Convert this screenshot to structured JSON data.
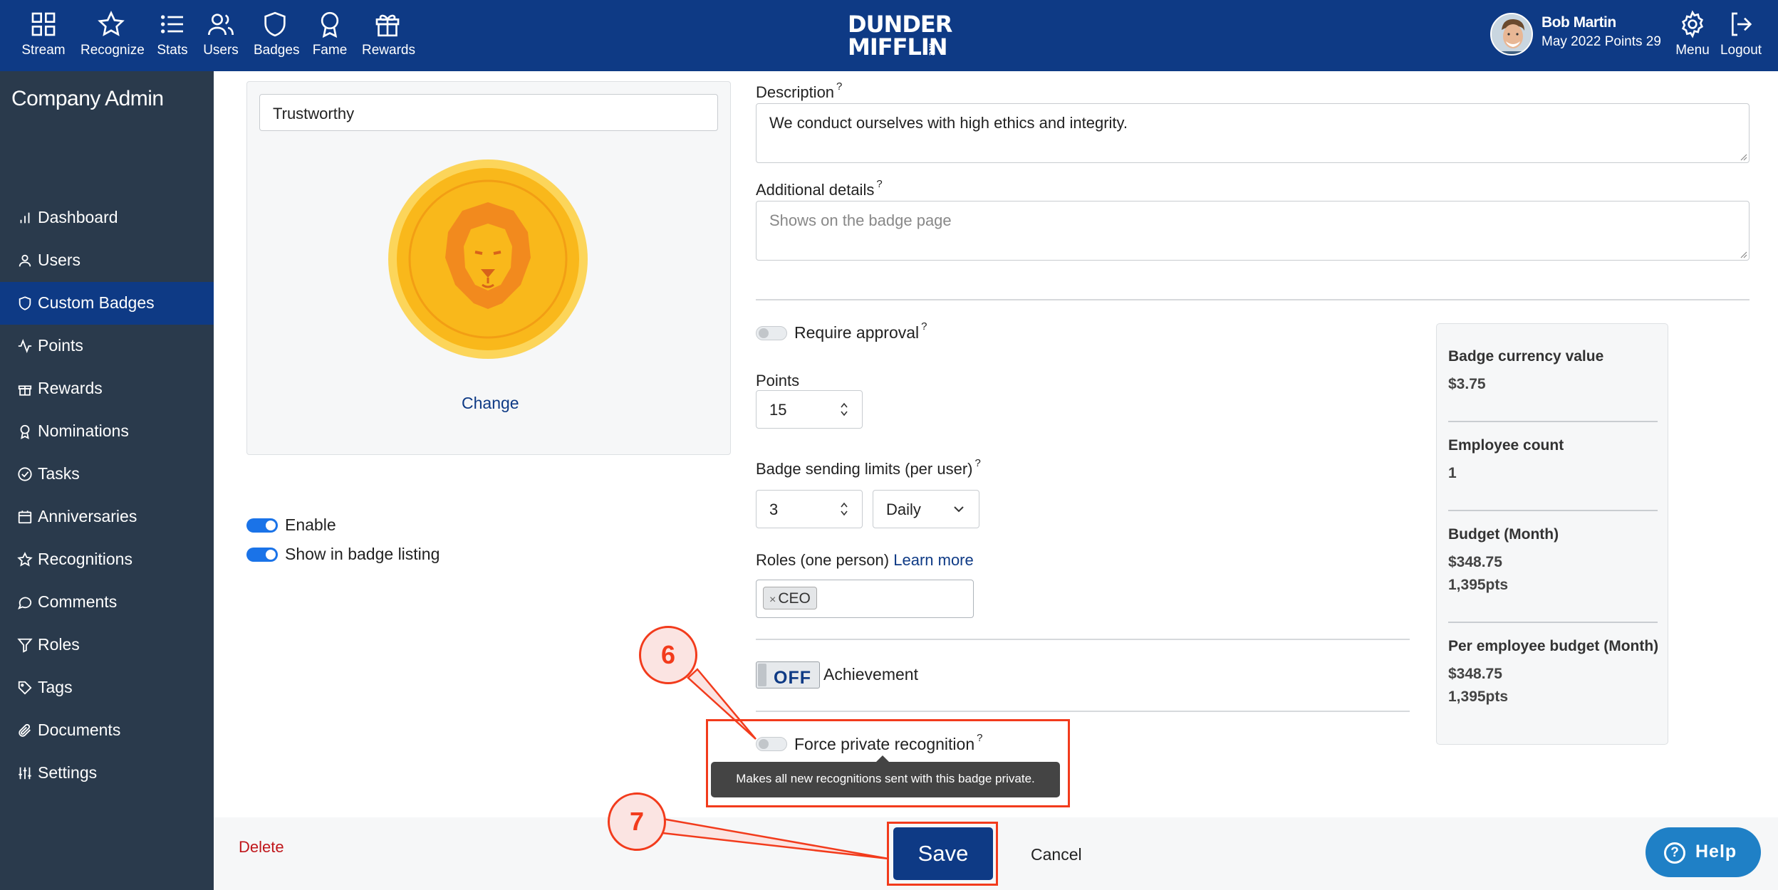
{
  "nav": {
    "items": [
      {
        "label": "Stream",
        "icon": "grid-icon"
      },
      {
        "label": "Recognize",
        "icon": "star-icon"
      },
      {
        "label": "Stats",
        "icon": "list-icon"
      },
      {
        "label": "Users",
        "icon": "users-icon"
      },
      {
        "label": "Badges",
        "icon": "shield-icon"
      },
      {
        "label": "Fame",
        "icon": "award-icon"
      },
      {
        "label": "Rewards",
        "icon": "gift-icon"
      }
    ],
    "logo_line1": "DUNDER",
    "logo_line2": "MIFFLIN",
    "logo_inc": "INC",
    "user_name": "Bob Martin",
    "user_points": "May 2022 Points 29",
    "menu_label": "Menu",
    "logout_label": "Logout"
  },
  "sidebar": {
    "title": "Company Admin",
    "items": [
      {
        "label": "Dashboard",
        "icon": "bar-chart-icon"
      },
      {
        "label": "Users",
        "icon": "user-icon"
      },
      {
        "label": "Custom Badges",
        "icon": "shield-icon",
        "active": true
      },
      {
        "label": "Points",
        "icon": "activity-icon"
      },
      {
        "label": "Rewards",
        "icon": "gift-icon"
      },
      {
        "label": "Nominations",
        "icon": "award-icon"
      },
      {
        "label": "Tasks",
        "icon": "check-circle-icon"
      },
      {
        "label": "Anniversaries",
        "icon": "calendar-icon"
      },
      {
        "label": "Recognitions",
        "icon": "star-icon"
      },
      {
        "label": "Comments",
        "icon": "comment-icon"
      },
      {
        "label": "Roles",
        "icon": "filter-icon"
      },
      {
        "label": "Tags",
        "icon": "tag-icon"
      },
      {
        "label": "Documents",
        "icon": "paperclip-icon"
      },
      {
        "label": "Settings",
        "icon": "sliders-icon"
      }
    ]
  },
  "badge": {
    "name": "Trustworthy",
    "change_label": "Change",
    "enable_label": "Enable",
    "show_listing_label": "Show in badge listing"
  },
  "form": {
    "description_label": "Description",
    "description_value": "We conduct ourselves with high ethics and integrity.",
    "additional_label": "Additional details",
    "additional_placeholder": "Shows on the badge page",
    "require_approval_label": "Require approval",
    "points_label": "Points",
    "points_value": "15",
    "limits_label": "Badge sending limits (per user)",
    "limits_value": "3",
    "limits_period": "Daily",
    "roles_label": "Roles (one person)",
    "roles_learn_more": "Learn more",
    "roles_tag": "CEO",
    "tag_remove": "×",
    "achievement_switch": "OFF",
    "achievement_label": "Achievement",
    "force_private_label": "Force private recognition",
    "help_mark": "?",
    "tooltip": "Makes all new recognitions sent with this badge private."
  },
  "stats": {
    "currency_label": "Badge currency value",
    "currency_value": "$3.75",
    "employee_label": "Employee count",
    "employee_value": "1",
    "budget_label": "Budget (Month)",
    "budget_value": "$348.75",
    "budget_pts": "1,395pts",
    "per_emp_label": "Per employee budget (Month)",
    "per_emp_value": "$348.75",
    "per_emp_pts": "1,395pts"
  },
  "footer": {
    "delete_label": "Delete",
    "save_label": "Save",
    "cancel_label": "Cancel",
    "help_label": "Help"
  },
  "annotations": {
    "step6": "6",
    "step7": "7",
    "color": "#f23b1c"
  },
  "colors": {
    "brand": "#0e3a85",
    "sidebar": "#2a3a4c",
    "toggle_on": "#1a73e8",
    "delete": "#c0161b",
    "help": "#1f80c6",
    "coin": "#f9b81b"
  }
}
